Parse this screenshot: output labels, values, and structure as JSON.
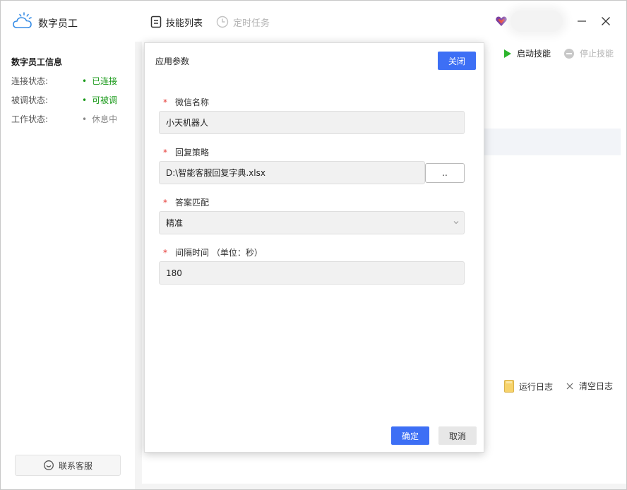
{
  "app": {
    "name": "数字员工"
  },
  "nav": {
    "tabs": [
      {
        "label": "技能列表"
      },
      {
        "label": "定时任务"
      }
    ]
  },
  "sidebar": {
    "title": "数字员工信息",
    "rows": [
      {
        "label": "连接状态:",
        "value": "已连接"
      },
      {
        "label": "被调状态:",
        "value": "可被调"
      },
      {
        "label": "工作状态:",
        "value": "休息中"
      }
    ],
    "contact_label": "联系客服"
  },
  "actions": {
    "start": "启动技能",
    "stop": "停止技能",
    "log": "运行日志",
    "clear": "清空日志"
  },
  "dialog": {
    "title": "应用参数",
    "close_label": "关闭",
    "fields": [
      {
        "label": "微信名称",
        "value": "小天机器人"
      },
      {
        "label": "回复策略",
        "value": "D:\\智能客服回复字典.xlsx",
        "button": ".."
      },
      {
        "label": "答案匹配",
        "value": "精准"
      },
      {
        "label": "间隔时间 （单位：秒）",
        "value": "180"
      }
    ],
    "ok_label": "确定",
    "cancel_label": "取消"
  },
  "colors": {
    "primary": "#3d6ff5",
    "success": "#1a9a1a",
    "required": "#e53935",
    "start_icon": "#2db52d"
  }
}
